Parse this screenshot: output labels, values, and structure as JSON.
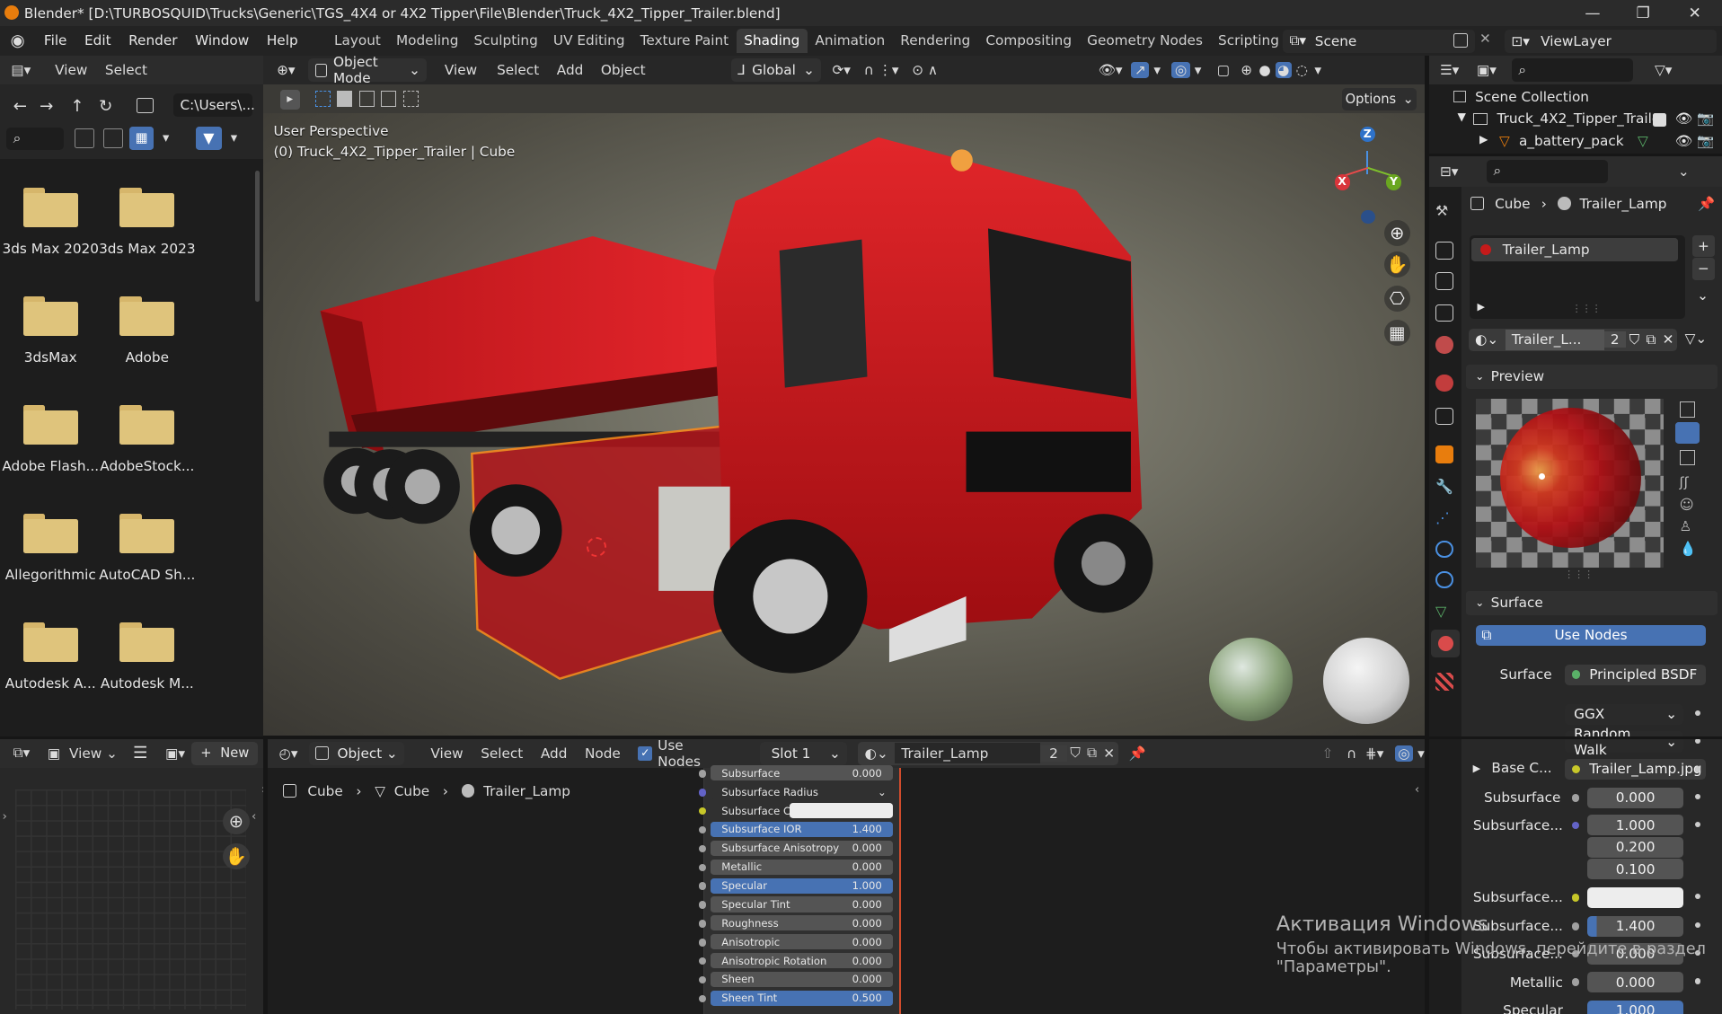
{
  "window": {
    "title": "Blender* [D:\\TURBOSQUID\\Trucks\\Generic\\TGS_4X4 or 4X2 Tipper\\File\\Blender\\Truck_4X2_Tipper_Trailer.blend]"
  },
  "menu": [
    "File",
    "Edit",
    "Render",
    "Window",
    "Help"
  ],
  "workspaces": [
    "Layout",
    "Modeling",
    "Sculpting",
    "UV Editing",
    "Texture Paint",
    "Shading",
    "Animation",
    "Rendering",
    "Compositing",
    "Geometry Nodes",
    "Scripting"
  ],
  "active_workspace": "Shading",
  "scene": "Scene",
  "view_layer": "ViewLayer",
  "file_browser": {
    "menus": [
      "View",
      "Select"
    ],
    "path": "C:\\Users\\...",
    "items": [
      "3ds Max 2020",
      "3ds Max 2023",
      "3dsMax",
      "Adobe",
      "Adobe Flash...",
      "AdobeStock...",
      "Allegorithmic",
      "AutoCAD Sh...",
      "Autodesk A...",
      "Autodesk M..."
    ]
  },
  "viewport": {
    "mode": "Object Mode",
    "menus": [
      "View",
      "Select",
      "Add",
      "Object"
    ],
    "orientation": "Global",
    "options": "Options",
    "perspective": "User Perspective",
    "object_info": "(0) Truck_4X2_Tipper_Trailer | Cube",
    "gizmo": {
      "x": "X",
      "y": "Y",
      "z": "Z"
    }
  },
  "outliner": {
    "root": "Scene Collection",
    "collection": "Truck_4X2_Tipper_Trailer",
    "child": "a_battery_pack"
  },
  "properties": {
    "breadcrumb": [
      "Cube",
      "Trailer_Lamp"
    ],
    "slot": "Trailer_Lamp",
    "material_name": "Trailer_L...",
    "users": "2",
    "preview_title": "Preview",
    "surface_title": "Surface",
    "use_nodes": "Use Nodes",
    "surface_label": "Surface",
    "surface_value": "Principled BSDF",
    "distribution": "GGX",
    "subsurface_method": "Random Walk",
    "base_color_label": "Base C...",
    "base_color_value": "Trailer_Lamp.jpg",
    "subsurface_label": "Subsurface",
    "subsurface_value": "0.000",
    "subsurface_radius_label": "Subsurface...",
    "radius": [
      "1.000",
      "0.200",
      "0.100"
    ],
    "subsurface_color_label": "Subsurface...",
    "subsurface_ior_label": "Subsurface...",
    "subsurface_ior": "1.400",
    "subsurface_aniso_label": "Subsurface...",
    "subsurface_aniso": "0.000",
    "metallic_label": "Metallic",
    "metallic": "0.000",
    "specular_label": "Specular",
    "specular": "1.000"
  },
  "node_editor": {
    "editor": "Object",
    "menus": [
      "View",
      "Select",
      "Add",
      "Node"
    ],
    "use_nodes": "Use Nodes",
    "slot": "Slot 1",
    "material": "Trailer_Lamp",
    "users": "2",
    "breadcrumb": [
      "Cube",
      "Cube",
      "Trailer_Lamp"
    ],
    "rows": [
      {
        "label": "Subsurface",
        "value": "0.000",
        "blue": false
      },
      {
        "label": "Subsurface Radius",
        "value": "",
        "blue": false
      },
      {
        "label": "Subsurface C...",
        "value": "",
        "blue": false
      },
      {
        "label": "Subsurface IOR",
        "value": "1.400",
        "blue": true
      },
      {
        "label": "Subsurface Anisotropy",
        "value": "0.000",
        "blue": false
      },
      {
        "label": "Metallic",
        "value": "0.000",
        "blue": false
      },
      {
        "label": "Specular",
        "value": "1.000",
        "blue": true
      },
      {
        "label": "Specular Tint",
        "value": "0.000",
        "blue": false
      },
      {
        "label": "Roughness",
        "value": "0.000",
        "blue": false
      },
      {
        "label": "Anisotropic",
        "value": "0.000",
        "blue": false
      },
      {
        "label": "Anisotropic Rotation",
        "value": "0.000",
        "blue": false
      },
      {
        "label": "Sheen",
        "value": "0.000",
        "blue": false
      },
      {
        "label": "Sheen Tint",
        "value": "0.500",
        "blue": true
      }
    ]
  },
  "image_editor": {
    "view": "View",
    "new": "New"
  },
  "watermark": {
    "line1": "Активация Windows",
    "line2": "Чтобы активировать Windows, перейдите в раздел",
    "line3": "\"Параметры\"."
  },
  "colors": {
    "accent": "#4772b3",
    "truck_red": "#c8141a",
    "folder": "#dfc47c",
    "select_orange": "#ff8c1a"
  }
}
